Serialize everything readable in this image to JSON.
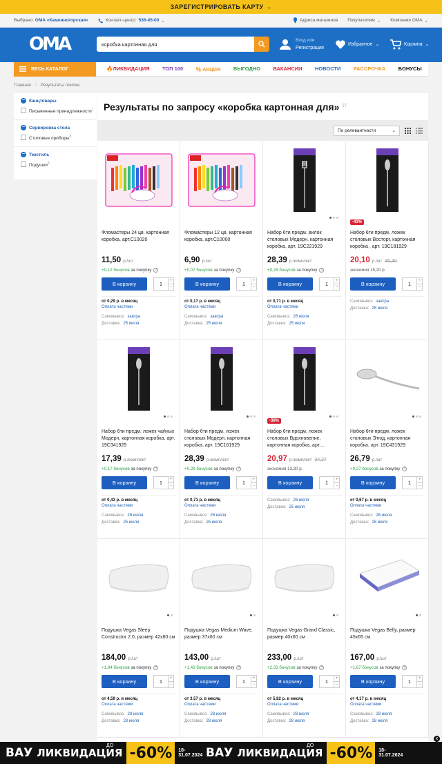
{
  "topbar": {
    "text": "ЗАРЕГИСТРИРОВАТЬ КАРТУ →"
  },
  "infobar": {
    "selected_label": "Выбрано:",
    "selected_store": "ОМА «Каменногорская»",
    "contact_label": "Контакт-центр:",
    "contact_phone": "536-45-00",
    "stores": "Адреса магазинов",
    "customers": "Покупателям",
    "company": "Компания ОМА"
  },
  "header": {
    "logo": "ОМА",
    "search_value": "коробка картонная для",
    "login_top": "Вход или",
    "login_bottom": "Регистрация",
    "favorites": "Избранное",
    "cart": "Корзина"
  },
  "nav": {
    "catalog": "ВЕСЬ КАТАЛОГ",
    "items": [
      {
        "label": "🔥ЛИКВИДАЦИЯ",
        "color": "#d72638"
      },
      {
        "label": "ТОП 100",
        "color": "#7a3fb0"
      },
      {
        "label": "％ АКЦИЯ",
        "color": "#f29a22"
      },
      {
        "label": "ВЫГОДНО",
        "color": "#2f9e44"
      },
      {
        "label": "ВАКАНСИИ",
        "color": "#d72638"
      },
      {
        "label": "НОВОСТИ",
        "color": "#1d6fc6"
      },
      {
        "label": "РАССРОЧКА",
        "color": "#f29a22"
      },
      {
        "label": "БОНУСЫ",
        "color": "#111111"
      }
    ]
  },
  "breadcrumbs": [
    "Главная",
    "Результаты поиска"
  ],
  "filters": [
    {
      "title": "Канцтовары",
      "items": [
        {
          "label": "Письменные принадлежности",
          "count": "1"
        }
      ]
    },
    {
      "title": "Сервировка стола",
      "items": [
        {
          "label": "Столовые приборы",
          "count": "8"
        }
      ]
    },
    {
      "title": "Текстиль",
      "items": [
        {
          "label": "Подушки",
          "count": "8"
        }
      ]
    }
  ],
  "results": {
    "title": "Результаты по запросу «коробка картонная для»",
    "count": "17",
    "sort": "По релевантности"
  },
  "common": {
    "buy": "В корзину",
    "qty": "1",
    "pickup": "Самовывоз:",
    "delivery": "Доставка:",
    "installments": "Оплата частями",
    "bonus_suffix": "за покупку"
  },
  "products": [
    {
      "name": "Фломастеры 24 цв. картонная коробка, арт.С10020",
      "price": "11,50",
      "unit": "р./шт",
      "bonus": "+0,12 бонусов",
      "installment": "от 0,29 р. в месяц",
      "pickup": "завтра",
      "delivery": "25 июля",
      "img": "markers",
      "dots": 0
    },
    {
      "name": "Фломастеры 12 цв. картонная коробка, арт.С10000",
      "price": "6,90",
      "unit": "р./шт",
      "bonus": "+0,07 бонусов",
      "installment": "от 0,17 р. в месяц",
      "pickup": "завтра",
      "delivery": "25 июля",
      "img": "markers",
      "dots": 0
    },
    {
      "name": "Набор 6ти предм. вилок столовых Модерн, картонная коробка, арт. 19С221929",
      "price": "28,39",
      "unit": "р./комплект",
      "bonus": "+0,28 бонусов",
      "installment": "от 0,71 р. в месяц",
      "pickup": "26 июля",
      "delivery": "25 июля",
      "img": "fork",
      "dots": 3
    },
    {
      "name": "Набор 6ти предм. ложек столовых Восторг, картонная коробка , арт. 19С181929",
      "price": "20,10",
      "old_price": "35,30",
      "unit": "р./шт",
      "saving": "экономия 15,20 р.",
      "discount": "-43%",
      "pickup": "завтра",
      "delivery": "25 июля",
      "img": "spoon",
      "dots": 0
    },
    {
      "name": "Набор 6ти предм. ложек чайных Модерн, картонная коробка, арт. 19С341929",
      "price": "17,39",
      "unit": "р./комплект",
      "bonus": "+0,17 бонусов",
      "installment": "от 0,43 р. в месяц",
      "pickup": "26 июля",
      "delivery": "25 июля",
      "img": "spoon",
      "dots": 3
    },
    {
      "name": "Набор 6ти предм. ложек столовых Модерн, картонная коробка, арт. 19С161929",
      "price": "28,39",
      "unit": "р./комплект",
      "bonus": "+0,28 бонусов",
      "installment": "от 0,71 р. в месяц",
      "pickup": "26 июля",
      "delivery": "25 июля",
      "img": "spoon",
      "dots": 3
    },
    {
      "name": "Набор 6ти предм. ложек столовых Вдохновение, картонная коробка, арт....",
      "price": "20,97",
      "old_price": "34,27",
      "unit": "р./комплект",
      "saving": "экономия 13,30 р.",
      "discount": "-38%",
      "pickup": "26 июля",
      "delivery": "25 июля",
      "img": "spoon",
      "dots": 3
    },
    {
      "name": "Набор 6ти предм. ложек столовых Этюд, картонная коробка, арт. 19С431929",
      "price": "26,79",
      "unit": "р./шт",
      "bonus": "+0,27 бонусов",
      "installment": "от 0,67 р. в месяц",
      "pickup": "26 июля",
      "delivery": "25 июля",
      "img": "spoonw",
      "dots": 3
    },
    {
      "name": "Подушка Vegas Sleep Constructor 2.0, размер 42х60 см",
      "price": "184,00",
      "unit": "р./шт",
      "bonus": "+1,84 бонусов",
      "installment": "от 4,59 р. в месяц",
      "pickup": "28 июля",
      "delivery": "28 июля",
      "img": "pillow",
      "dots": 2
    },
    {
      "name": "Подушка Vegas Medium Wave, размер 37х60 см",
      "price": "143,00",
      "unit": "р./шт",
      "bonus": "+1,43 бонусов",
      "installment": "от 3,57 р. в месяц",
      "pickup": "28 июля",
      "delivery": "28 июля",
      "img": "pillow",
      "dots": 2
    },
    {
      "name": "Подушка Vegas Grand Classic, размер 40х60 см",
      "price": "233,00",
      "unit": "р./шт",
      "bonus": "+2,33 бонусов",
      "installment": "от 5,82 р. в месяц",
      "pickup": "28 июля",
      "delivery": "28 июля",
      "img": "pillow",
      "dots": 2
    },
    {
      "name": "Подушка Vegas Belly, размер 45х65 см",
      "price": "167,00",
      "unit": "р./шт",
      "bonus": "+1,67 бонусов",
      "installment": "от 4,17 р. в месяц",
      "pickup": "28 июля",
      "delivery": "28 июля",
      "img": "pillowflat",
      "dots": 2
    }
  ],
  "banner": {
    "word1": "ВАУ",
    "word2": "ЛИКВИДАЦИЯ",
    "prefix": "ДО",
    "percent": "-60%",
    "dates": "18-31.07.2024"
  },
  "close": "x"
}
